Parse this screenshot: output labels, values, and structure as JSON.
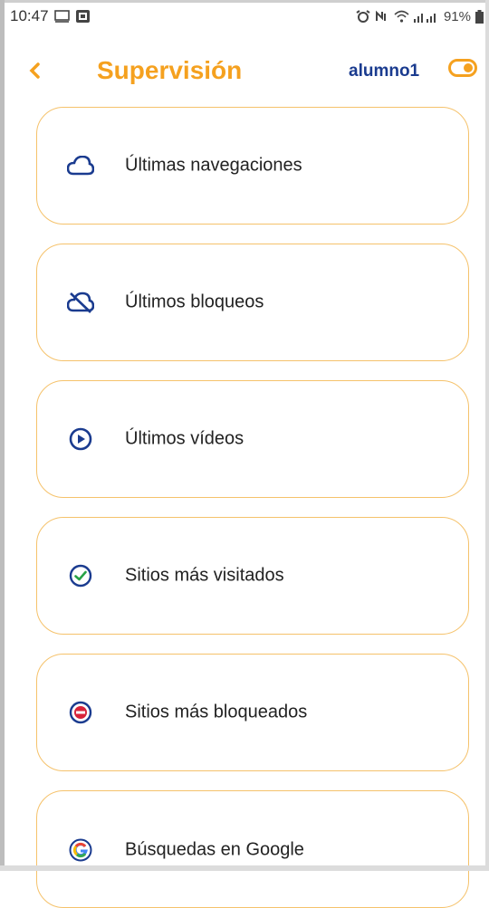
{
  "status_bar": {
    "time": "10:47",
    "battery": "91%"
  },
  "header": {
    "back_label": "<",
    "title": "Supervisión",
    "user": "alumno1"
  },
  "colors": {
    "accent": "#f5a11f",
    "navy": "#1a3b8f",
    "card_border": "#f5c26b"
  },
  "menu": {
    "items": [
      {
        "label": "Últimas navegaciones",
        "icon": "cloud-icon"
      },
      {
        "label": "Últimos bloqueos",
        "icon": "cloud-off-icon"
      },
      {
        "label": "Últimos vídeos",
        "icon": "play-circle-icon"
      },
      {
        "label": "Sitios más visitados",
        "icon": "check-circle-icon"
      },
      {
        "label": "Sitios más bloqueados",
        "icon": "block-circle-icon"
      },
      {
        "label": "Búsquedas en Google",
        "icon": "google-icon"
      }
    ]
  }
}
